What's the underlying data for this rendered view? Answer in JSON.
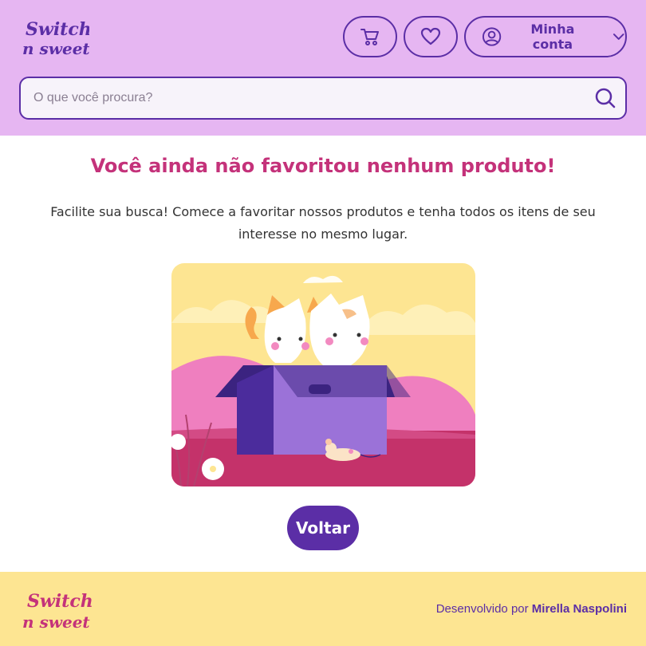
{
  "header": {
    "logo_line1": "Switch",
    "logo_line2": "n sweet",
    "cart_icon": "cart-icon",
    "favorites_icon": "heart-icon",
    "account_icon": "user-circle-icon",
    "account_label": "Minha conta",
    "account_chevron": "chevron-down-icon"
  },
  "search": {
    "placeholder": "O que você procura?",
    "value": "",
    "icon": "search-icon"
  },
  "main": {
    "title": "Você ainda não favoritou nenhum produto!",
    "description": "Facilite sua busca! Comece a favoritar nossos produtos e tenha todos os itens de seu interesse no mesmo lugar.",
    "back_label": "Voltar"
  },
  "footer": {
    "logo_line1": "Switch",
    "logo_line2": "n sweet",
    "credit_prefix": "Desenvolvido por",
    "credit_name": "Mirella Naspolini"
  },
  "colors": {
    "header_bg": "#e6b6f2",
    "primary": "#5b2ea6",
    "accent": "#c4327a",
    "footer_bg": "#fde592"
  }
}
